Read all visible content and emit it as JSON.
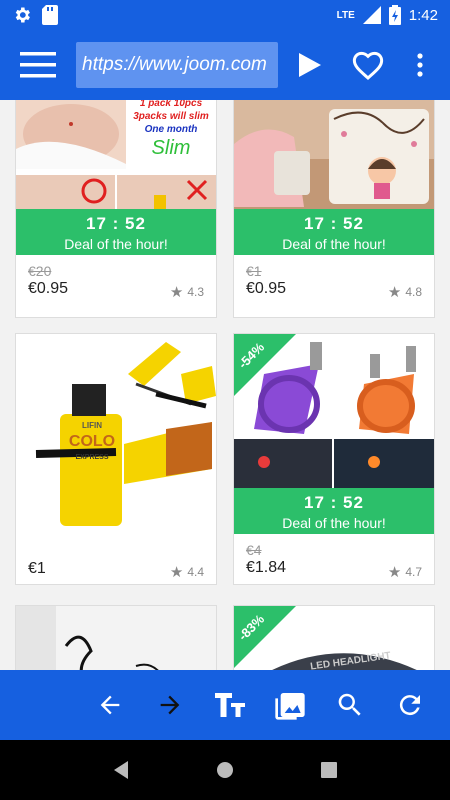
{
  "status": {
    "time": "1:42",
    "network": "LTE"
  },
  "toolbar": {
    "url": "https://www.joom.com"
  },
  "deal_label": "Deal of the hour!",
  "products": [
    {
      "timer": "17 : 52",
      "old_price": "€20",
      "price": "€0.95",
      "rating": "4.3",
      "ad_text": [
        "1 pack 10pcs",
        "3packs will slim",
        "One month",
        "Slim"
      ]
    },
    {
      "timer": "17 : 52",
      "old_price": "€1",
      "price": "€0.95",
      "rating": "4.8"
    },
    {
      "price": "€1",
      "rating": "4.4",
      "box_text": [
        "LIFIN",
        "COLO",
        "EXPRESS"
      ]
    },
    {
      "timer": "17 : 52",
      "old_price": "€4",
      "price": "€1.84",
      "rating": "4.7",
      "discount": "-54%"
    },
    {},
    {
      "discount": "-83%",
      "print_text": "LED HEADLIGHT"
    }
  ],
  "colors": {
    "primary": "#1660e0",
    "deal": "#2cbf6a"
  }
}
